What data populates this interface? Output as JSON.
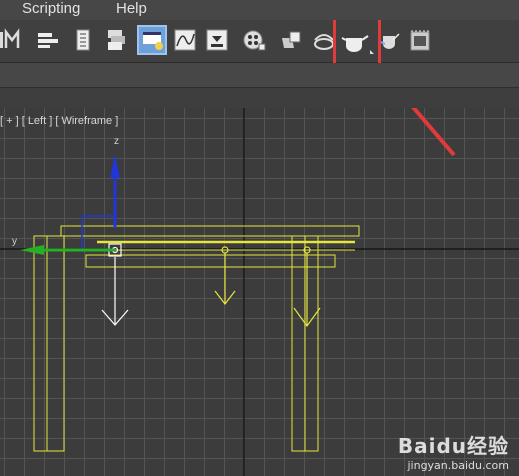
{
  "menubar": {
    "items": [
      "Scripting",
      "Help"
    ]
  },
  "toolbar": {
    "icons": [
      "mirror-icon",
      "align-icon",
      "scene-explorer-icon",
      "layer-manager-icon",
      "ribbon-icon",
      "curve-editor-icon",
      "schematic-view-icon",
      "material-editor-icon",
      "render-setup-icon",
      "rendered-frame-window-icon",
      "render-production-icon",
      "render-iterative-icon",
      "render-to-texture-icon"
    ],
    "highlighted_icon": "render-production-icon",
    "highlight_color": "#e03a3a"
  },
  "viewport": {
    "label": "[ + ] [ Left ] [ Wireframe ]",
    "axis_y_label": "y",
    "axis_z_label": "z",
    "wire_color": "#e6e63c"
  },
  "annotation": {
    "arrow_color": "#e03a3a"
  },
  "watermark": {
    "logo": "Baidu经验",
    "url": "jingyan.baidu.com"
  }
}
